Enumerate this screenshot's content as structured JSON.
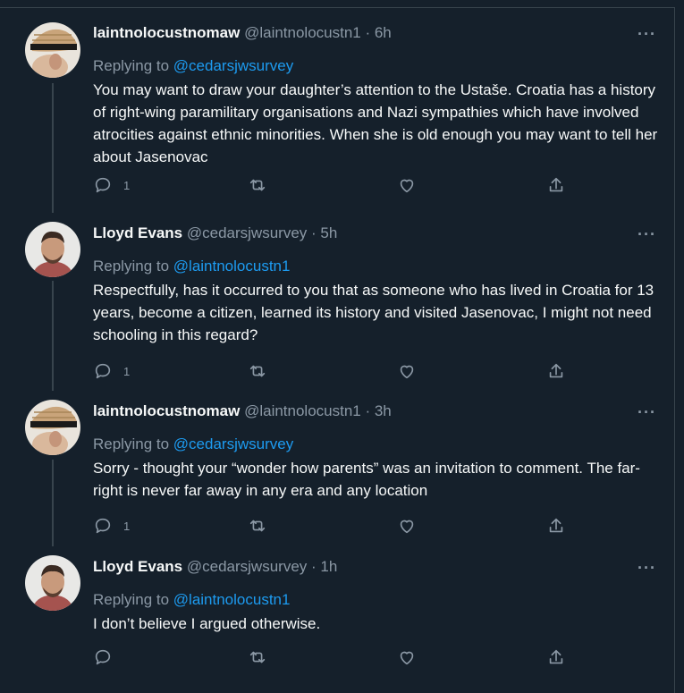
{
  "tweets": [
    {
      "name": "laintnolocustnomaw",
      "meta": "@laintnolocustn1 · 6h",
      "reply_prefix": "Replying to ",
      "reply_handle": "@cedarsjwsurvey",
      "text": "You may want to draw your daughter’s attention to the Ustaše. Croatia has a history of right-wing paramilitary organisations and Nazi sympathies which have involved atrocities against ethnic minorities. When she is old enough you may want to tell her about  Jasenovac",
      "reply_count": "1",
      "avatar": "straw-hat-avatar"
    },
    {
      "name": "Lloyd Evans",
      "meta": "@cedarsjwsurvey · 5h",
      "reply_prefix": "Replying to ",
      "reply_handle": "@laintnolocustn1",
      "text": "Respectfully, has it occurred to you that as someone who has lived in Croatia for 13 years, become a citizen, learned its history and visited Jasenovac, I might not need schooling in this regard?",
      "reply_count": "1",
      "avatar": "person-avatar"
    },
    {
      "name": "laintnolocustnomaw",
      "meta": "@laintnolocustn1 · 3h",
      "reply_prefix": "Replying to ",
      "reply_handle": "@cedarsjwsurvey",
      "text": "Sorry - thought your “wonder how parents” was an invitation to comment. The far-right is never far away in any era and any location",
      "reply_count": "1",
      "avatar": "straw-hat-avatar"
    },
    {
      "name": "Lloyd Evans",
      "meta": "@cedarsjwsurvey · 1h",
      "reply_prefix": "Replying to ",
      "reply_handle": "@laintnolocustn1",
      "text": "I don’t believe I argued otherwise.",
      "reply_count": "",
      "avatar": "person-avatar"
    }
  ],
  "more_icon": "more-horizontal-icon",
  "colors": {
    "background": "#15202b",
    "text": "#f7f9f9",
    "secondary": "#8b98a5",
    "link": "#1d9bf0",
    "border": "#38444d"
  }
}
